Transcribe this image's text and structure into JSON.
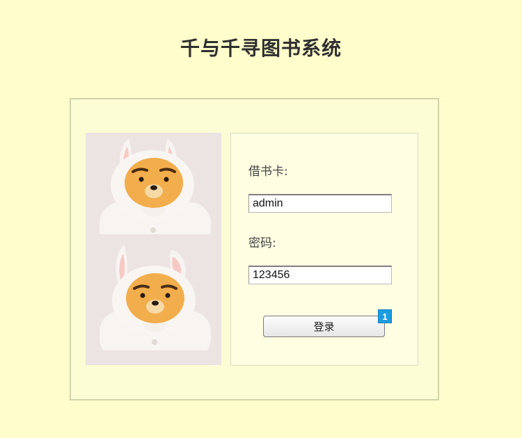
{
  "header": {
    "title": "千与千寻图书系统"
  },
  "login_form": {
    "card_label": "借书卡:",
    "card_value": "admin",
    "password_label": "密码:",
    "password_value": "123456",
    "submit_label": "登录",
    "submit_badge": "1"
  },
  "illustration": {
    "icon": "bunny-costume-bear-icon",
    "background_color": "#ece3e3"
  },
  "colors": {
    "page_background": "#fefdcb",
    "panel_background": "#fefee2",
    "badge": "#1d9ce0"
  }
}
